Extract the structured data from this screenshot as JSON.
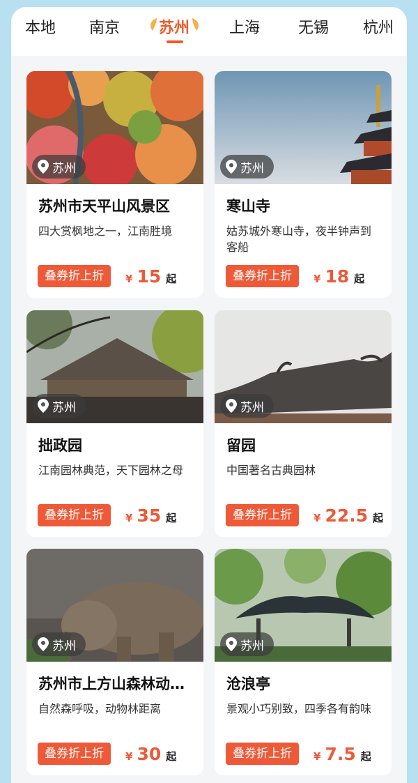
{
  "tabs": [
    {
      "label": "本地"
    },
    {
      "label": "南京"
    },
    {
      "label": "苏州"
    },
    {
      "label": "上海"
    },
    {
      "label": "无锡"
    },
    {
      "label": "杭州"
    }
  ],
  "active_tab": "苏州",
  "colors": {
    "accent": "#f05a28",
    "coupon": "#ee5a38",
    "background": "#b8e0f0"
  },
  "cards": [
    {
      "location": "苏州",
      "title": "苏州市天平山风景区",
      "desc": "四大赏枫地之一，江南胜境",
      "coupon": "叠券折上折",
      "currency": "¥",
      "price": "15",
      "suffix": "起"
    },
    {
      "location": "苏州",
      "title": "寒山寺",
      "desc": "姑苏城外寒山寺，夜半钟声到客船",
      "coupon": "叠券折上折",
      "currency": "¥",
      "price": "18",
      "suffix": "起"
    },
    {
      "location": "苏州",
      "title": "拙政园",
      "desc": "江南园林典范，天下园林之母",
      "coupon": "叠券折上折",
      "currency": "¥",
      "price": "35",
      "suffix": "起"
    },
    {
      "location": "苏州",
      "title": "留园",
      "desc": "中国著名古典园林",
      "coupon": "叠券折上折",
      "currency": "¥",
      "price": "22.5",
      "suffix": "起"
    },
    {
      "location": "苏州",
      "title": "苏州市上方山森林动物世界",
      "desc": "自然森呼吸，动物林距离",
      "coupon": "叠券折上折",
      "currency": "¥",
      "price": "30",
      "suffix": "起"
    },
    {
      "location": "苏州",
      "title": "沧浪亭",
      "desc": "景观小巧别致，四季各有韵味",
      "coupon": "叠券折上折",
      "currency": "¥",
      "price": "7.5",
      "suffix": "起"
    }
  ]
}
